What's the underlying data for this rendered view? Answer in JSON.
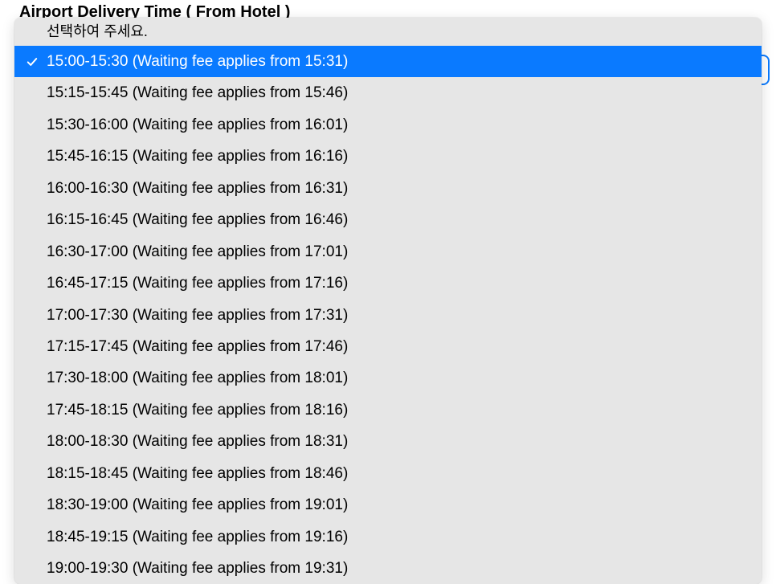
{
  "header": {
    "title": "Airport Delivery Time ( From Hotel )"
  },
  "dropdown": {
    "placeholder": "선택하여 주세요.",
    "selectedIndex": 0,
    "options": [
      "15:00-15:30 (Waiting fee applies from 15:31)",
      "15:15-15:45 (Waiting fee applies from 15:46)",
      "15:30-16:00 (Waiting fee applies from 16:01)",
      "15:45-16:15 (Waiting fee applies from 16:16)",
      "16:00-16:30 (Waiting fee applies from 16:31)",
      "16:15-16:45 (Waiting fee applies from 16:46)",
      "16:30-17:00 (Waiting fee applies from 17:01)",
      "16:45-17:15 (Waiting fee applies from 17:16)",
      "17:00-17:30 (Waiting fee applies from 17:31)",
      "17:15-17:45 (Waiting fee applies from 17:46)",
      "17:30-18:00 (Waiting fee applies from 18:01)",
      "17:45-18:15 (Waiting fee applies from 18:16)",
      "18:00-18:30 (Waiting fee applies from 18:31)",
      "18:15-18:45 (Waiting fee applies from 18:46)",
      "18:30-19:00 (Waiting fee applies from 19:01)",
      "18:45-19:15 (Waiting fee applies from 19:16)",
      "19:00-19:30 (Waiting fee applies from 19:31)"
    ]
  }
}
